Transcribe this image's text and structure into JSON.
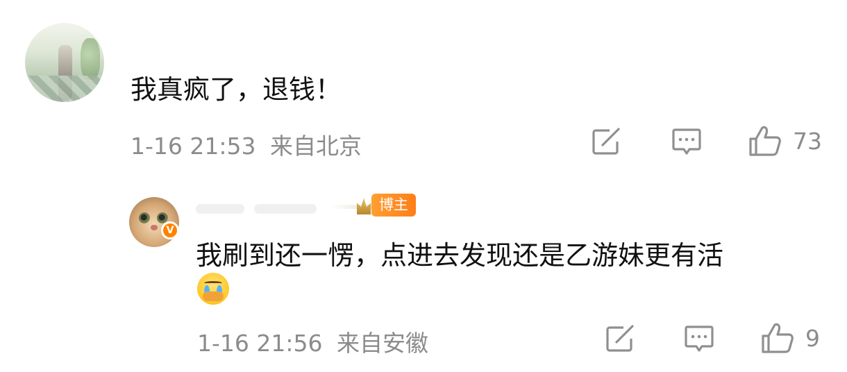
{
  "comments": [
    {
      "text": "我真疯了，退钱！",
      "time": "1-16 21:53",
      "location": "来自北京",
      "likes": "73"
    },
    {
      "text_line1": "我刷到还一愣，点进去发现还是乙游妹更有活",
      "badge": "博主",
      "emoji_icon": "crying-emoji-icon",
      "verified_icon": "verified-v-icon",
      "verified_mark": "V",
      "time": "1-16 21:56",
      "location": "来自安徽",
      "likes": "9"
    }
  ],
  "action_icons": [
    "share-icon",
    "comment-icon",
    "like-icon"
  ],
  "colors": {
    "badge": "#ff8200",
    "meta_text": "#8b8b8b",
    "icon_stroke": "#8f8f8f"
  }
}
